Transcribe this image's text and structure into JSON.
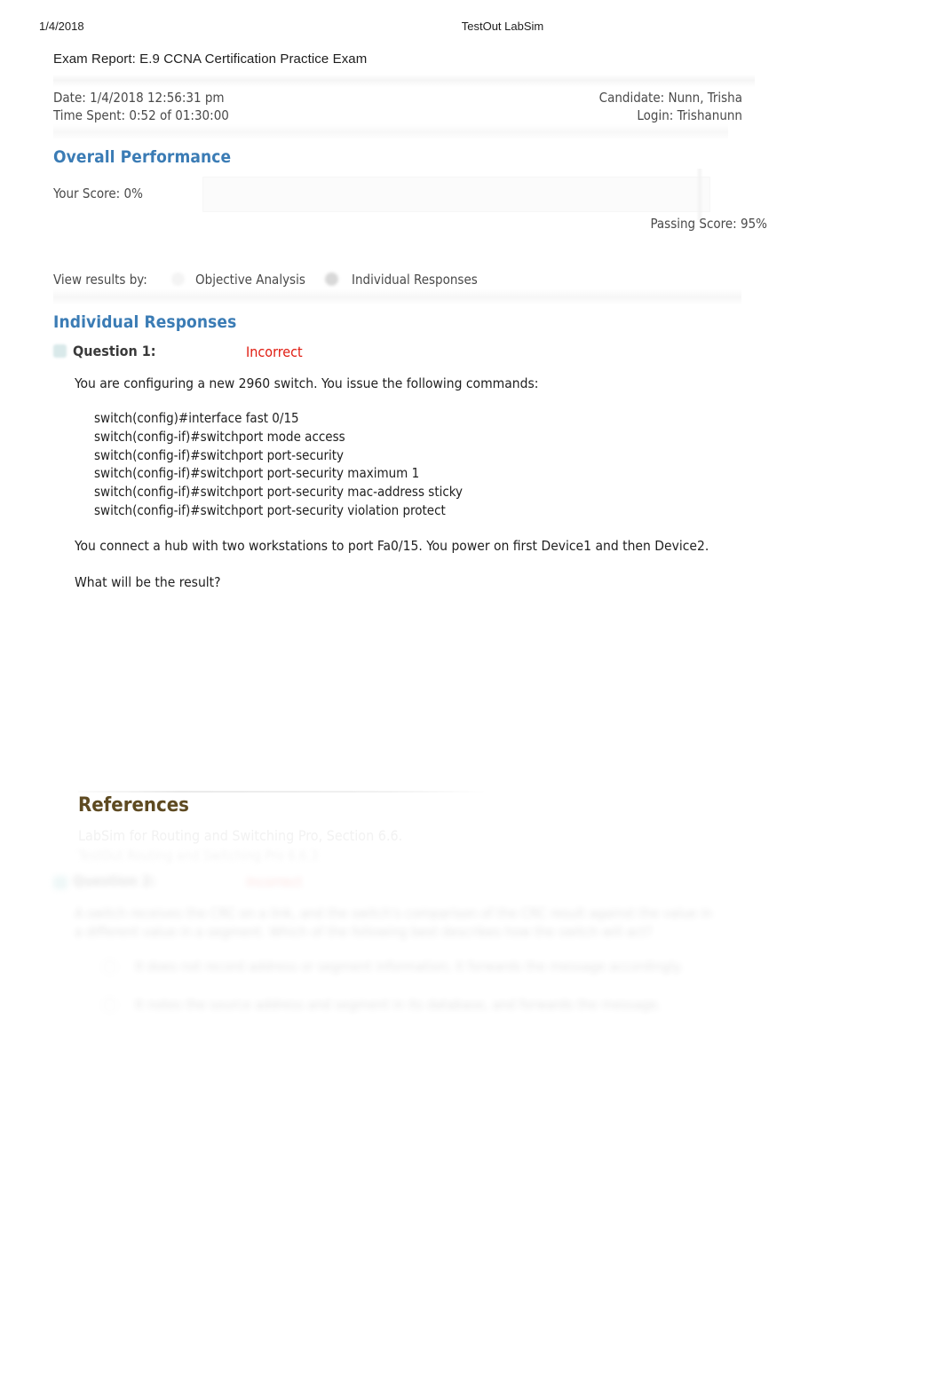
{
  "print_header": {
    "date": "1/4/2018",
    "app_title": "TestOut LabSim"
  },
  "report": {
    "title": "Exam Report: E.9 CCNA Certification Practice Exam",
    "meta": {
      "date_label": "Date: 1/4/2018 12:56:31 pm",
      "time_spent_label": "Time Spent: 0:52 of 01:30:00",
      "candidate_label": "Candidate: Nunn, Trisha",
      "login_label": "Login: Trishanunn"
    }
  },
  "overall_performance": {
    "heading": "Overall Performance",
    "your_score_label": "Your Score: 0%",
    "your_score_value": 0,
    "passing_score_label": "Passing Score:  95%",
    "passing_score_value": 95,
    "bar_track_color": "#fbfbfb",
    "bar_fill_color": "#f2f2f2"
  },
  "view_results_by": {
    "label": "View results by:",
    "options": [
      {
        "label": "Objective Analysis",
        "selected": false
      },
      {
        "label": "Individual Responses",
        "selected": true
      }
    ]
  },
  "individual_responses": {
    "heading": "Individual Responses",
    "question": {
      "label": "Question 1:",
      "status": "Incorrect",
      "status_color": "#e01b10",
      "intro": "You are configuring a new 2960 switch. You issue the following commands:",
      "commands": [
        "switch(config)#interface fast 0/15",
        "switch(config-if)#switchport mode access",
        "switch(config-if)#switchport port-security",
        "switch(config-if)#switchport port-security maximum 1",
        "switch(config-if)#switchport port-security mac-address sticky",
        "switch(config-if)#switchport port-security violation protect"
      ],
      "scenario": "You connect a hub with two workstations to port Fa0/15. You power on first Device1 and then Device2.",
      "question_text": "What will be the result?"
    }
  },
  "references": {
    "heading": "References",
    "items": [
      "LabSim for Routing and Switching Pro, Section 6.6.",
      "TestOut Routing and Switching Pro  6.6.3"
    ]
  },
  "next_question_faded": {
    "label": "Question 2:",
    "status": "Incorrect",
    "paragraph": "A switch receives the CRC on a link, and the switch's comparison of the CRC result against the value in a different value in a segment. Which of the following best describes how the switch will act?",
    "options": [
      "It does not record address or segment information; it forwards the message accordingly.",
      "It notes the source address and segment in its database, and forwards the message."
    ]
  },
  "colors": {
    "heading_blue": "#3b7cb5",
    "references_brown": "#5e4a21",
    "incorrect_red": "#e01b10",
    "body_text": "#1f1f1f",
    "meta_text": "#4a4a4a"
  }
}
